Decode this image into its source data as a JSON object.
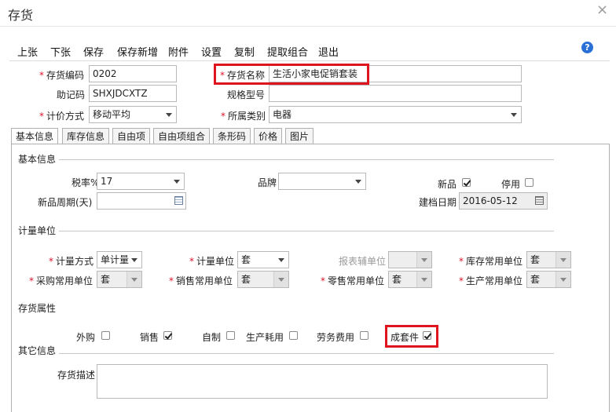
{
  "window": {
    "title": "存货",
    "close_glyph": "×"
  },
  "toolbar": [
    "上张",
    "下张",
    "保存",
    "保存新增",
    "附件",
    "设置",
    "复制",
    "提取组合",
    "退出"
  ],
  "header": {
    "code_label": "存货编码",
    "code_value": "0202",
    "name_label": "存货名称",
    "name_value": "生活小家电促销套装",
    "mnemonic_label": "助记码",
    "mnemonic_value": "SHXJDCXTZ",
    "spec_label": "规格型号",
    "spec_value": "",
    "costing_label": "计价方式",
    "costing_value": "移动平均",
    "category_label": "所属类别",
    "category_value": "电器"
  },
  "tabs": [
    "基本信息",
    "库存信息",
    "自由项",
    "自由项组合",
    "条形码",
    "价格",
    "图片"
  ],
  "basic": {
    "section_title": "基本信息",
    "tax_label": "税率%",
    "tax_value": "17",
    "brand_label": "品牌",
    "brand_value": "",
    "new_label": "新品",
    "new_checked": true,
    "disabled_label": "停用",
    "disabled_checked": false,
    "new_period_label": "新品周期(天)",
    "new_period_value": "",
    "created_label": "建档日期",
    "created_value": "2016-05-12"
  },
  "units": {
    "section_title": "计量单位",
    "method_label": "计量方式",
    "method_value": "单计量",
    "unit_label": "计量单位",
    "unit_value": "套",
    "report_label": "报表辅单位",
    "report_value": "",
    "stock_label": "库存常用单位",
    "stock_value": "套",
    "purchase_label": "采购常用单位",
    "purchase_value": "套",
    "sales_label": "销售常用单位",
    "sales_value": "套",
    "retail_label": "零售常用单位",
    "retail_value": "套",
    "production_label": "生产常用单位",
    "production_value": "套"
  },
  "attributes": {
    "section_title": "存货属性",
    "items": [
      {
        "label": "外购",
        "checked": false
      },
      {
        "label": "销售",
        "checked": true
      },
      {
        "label": "自制",
        "checked": false
      },
      {
        "label": "生产耗用",
        "checked": false
      },
      {
        "label": "劳务费用",
        "checked": false
      },
      {
        "label": "成套件",
        "checked": true
      }
    ]
  },
  "other": {
    "section_title": "其它信息",
    "desc_label": "存货描述",
    "desc_value": ""
  },
  "colors": {
    "required": "#d9142b",
    "highlight": "#e0141f",
    "help": "#2a6fd6"
  }
}
